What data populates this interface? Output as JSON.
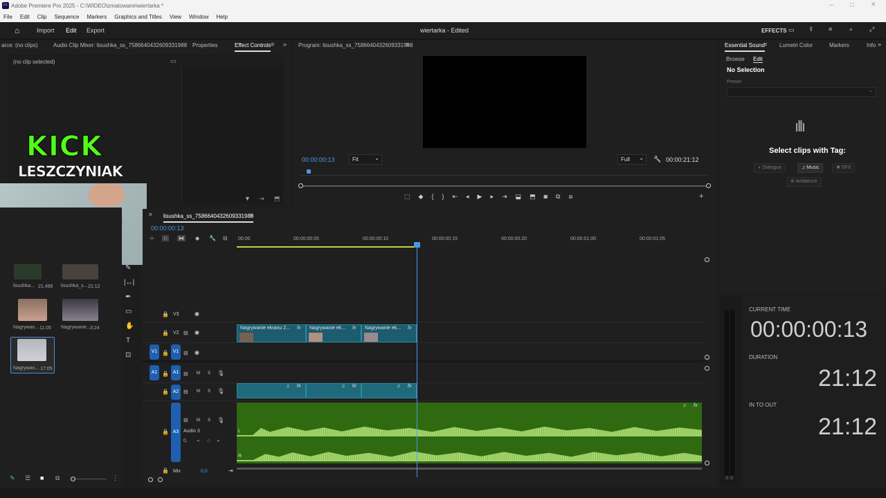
{
  "window": {
    "title": "Adobe Premiere Pro 2025 - C:\\WIDEO\\zmatowane\\wiertarka *"
  },
  "menu": [
    "File",
    "Edit",
    "Clip",
    "Sequence",
    "Markers",
    "Graphics and Titles",
    "View",
    "Window",
    "Help"
  ],
  "workspace": {
    "tabs": [
      "Import",
      "Edit",
      "Export"
    ],
    "project_title": "wiertarka - Edited",
    "effects_label": "EFFECTS"
  },
  "source_panel": {
    "tabs": [
      "arce: (no clips)",
      "Audio Clip Mixer: lisushka_ss_7586640432609331988",
      "Properties",
      "Effect Controls"
    ],
    "no_clip": "(no clip selected)"
  },
  "overlay": {
    "line1": "KICK",
    "line2": "LESZCZYNIAK"
  },
  "program": {
    "tab": "Program: lisushka_ss_7586640432609331988",
    "timecode": "00:00:00:13",
    "fit": "Fit",
    "quality": "Full",
    "duration": "00:00:21:12"
  },
  "project_bin": {
    "items": [
      {
        "name": "lisushka...",
        "dur": "21,498"
      },
      {
        "name": "lisushka_s...",
        "dur": "21:12"
      },
      {
        "name": "Nagrywan...",
        "dur": "11:05"
      },
      {
        "name": "Nagrywanie...",
        "dur": "3:24"
      },
      {
        "name": "Nagrywan...",
        "dur": "17:05"
      }
    ]
  },
  "timeline": {
    "tab": "lisushka_ss_7586640432609331988",
    "timecode": "00:00:00:13",
    "ruler": [
      "00:00",
      "00:00:00:05",
      "00:00:00:10",
      "00:00:00:15",
      "00:00:00:20",
      "00:00:01:00",
      "00:00:01:05"
    ],
    "tracks": {
      "v3": "V3",
      "v2": "V2",
      "v1": "V1",
      "a1": "A1",
      "a2": "A2",
      "a3": "A3",
      "audio3": "Audio 3",
      "mix": "Mix",
      "mix_val": "0,0",
      "m": "M",
      "s": "S",
      "l": "L",
      "r": "R",
      "src_v1": "V1",
      "src_a1": "A1"
    },
    "clips": [
      "Nagrywanie ekranu 2...",
      "Nagrywanie ek...",
      "Nagrywanie ek..."
    ],
    "fx": "fx"
  },
  "essential_sound": {
    "tabs": [
      "Essential Sound",
      "Lumetri Color",
      "Markers",
      "Info"
    ],
    "subtabs": [
      "Browse",
      "Edit"
    ],
    "no_selection": "No Selection",
    "preset_label": "Preset:",
    "prompt": "Select clips with Tag:",
    "tags": [
      "Dialogue",
      "Music",
      "SFX",
      "Ambience"
    ]
  },
  "info_panel": {
    "current_time_label": "CURRENT TIME",
    "current_time": "00:00:00:13",
    "duration_label": "DURATION",
    "duration": "21:12",
    "in_out_label": "IN TO OUT",
    "in_out": "21:12"
  },
  "colors": {
    "accent_blue": "#2b7fd9",
    "audio_green": "#3e7a13",
    "clip_teal": "#1b5c6e",
    "kick_green": "#53fc18"
  }
}
